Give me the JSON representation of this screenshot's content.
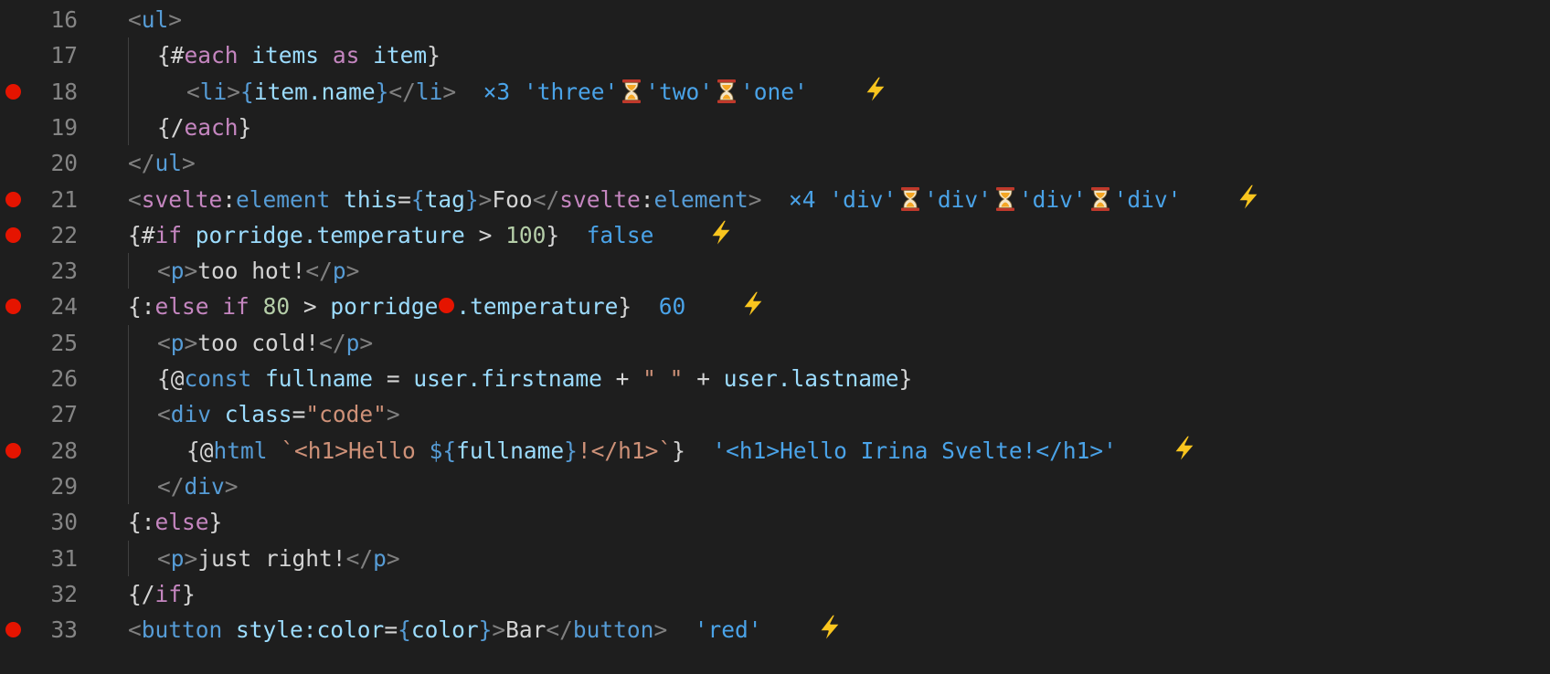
{
  "lines": [
    {
      "n": "16",
      "bp": false
    },
    {
      "n": "17",
      "bp": false
    },
    {
      "n": "18",
      "bp": true
    },
    {
      "n": "19",
      "bp": false
    },
    {
      "n": "20",
      "bp": false
    },
    {
      "n": "21",
      "bp": true
    },
    {
      "n": "22",
      "bp": true
    },
    {
      "n": "23",
      "bp": false
    },
    {
      "n": "24",
      "bp": true
    },
    {
      "n": "25",
      "bp": false
    },
    {
      "n": "26",
      "bp": false
    },
    {
      "n": "27",
      "bp": false
    },
    {
      "n": "28",
      "bp": true
    },
    {
      "n": "29",
      "bp": false
    },
    {
      "n": "30",
      "bp": false
    },
    {
      "n": "31",
      "bp": false
    },
    {
      "n": "32",
      "bp": false
    },
    {
      "n": "33",
      "bp": true
    }
  ],
  "tokens": {
    "l16": {
      "lt": "<",
      "ul": "ul",
      "gt": ">"
    },
    "l17": {
      "open": "{#",
      "each": "each",
      "items": "items",
      "as": "as",
      "item": "item",
      "close": "}"
    },
    "l18": {
      "lt": "<",
      "li": "li",
      "gt": ">",
      "ob": "{",
      "expr": "item.name",
      "cb": "}",
      "lt2": "</",
      "li2": "li",
      "gt2": ">",
      "anno_count": "×3",
      "v1": "'three'",
      "v2": "'two'",
      "v3": "'one'"
    },
    "l19": {
      "open": "{/",
      "each": "each",
      "close": "}"
    },
    "l20": {
      "lt": "</",
      "ul": "ul",
      "gt": ">"
    },
    "l21": {
      "lt": "<",
      "ns": "svelte",
      "colon": ":",
      "el": "element",
      "attr": "this",
      "eq": "=",
      "ob": "{",
      "tag": "tag",
      "cb": "}",
      "gt": ">",
      "text": "Foo",
      "lt2": "</",
      "ns2": "svelte",
      "colon2": ":",
      "el2": "element",
      "gt2": ">",
      "anno_count": "×4",
      "v1": "'div'",
      "v2": "'div'",
      "v3": "'div'",
      "v4": "'div'"
    },
    "l22": {
      "open": "{#",
      "kw": "if",
      "var": "porridge.temperature",
      "op": ">",
      "num": "100",
      "close": "}",
      "anno": "false"
    },
    "l23": {
      "lt": "<",
      "p": "p",
      "gt": ">",
      "text": "too hot!",
      "lt2": "</",
      "p2": "p",
      "gt2": ">"
    },
    "l24": {
      "open": "{:",
      "kw1": "else",
      "kw2": "if",
      "num": "80",
      "op": ">",
      "var1": "porridge",
      "var2": ".temperature",
      "close": "}",
      "anno": "60"
    },
    "l25": {
      "lt": "<",
      "p": "p",
      "gt": ">",
      "text": "too cold!",
      "lt2": "</",
      "p2": "p",
      "gt2": ">"
    },
    "l26": {
      "open": "{@",
      "kw": "const",
      "name": "fullname",
      "eq": "=",
      "v1": "user.firstname",
      "plus": "+",
      "str": "\" \"",
      "plus2": "+",
      "v2": "user.lastname",
      "close": "}"
    },
    "l27": {
      "lt": "<",
      "div": "div",
      "attr": "class",
      "eq": "=",
      "str": "\"code\"",
      "gt": ">"
    },
    "l28": {
      "open": "{@",
      "kw": "html",
      "tpl1": "`<h1>Hello ",
      "dl": "${",
      "var": "fullname",
      "rb": "}",
      "tpl2": "!</h1>`",
      "close": "}",
      "anno": "'<h1>Hello Irina Svelte!</h1>'"
    },
    "l29": {
      "lt": "</",
      "div": "div",
      "gt": ">"
    },
    "l30": {
      "open": "{:",
      "kw": "else",
      "close": "}"
    },
    "l31": {
      "lt": "<",
      "p": "p",
      "gt": ">",
      "text": "just right!",
      "lt2": "</",
      "p2": "p",
      "gt2": ">"
    },
    "l32": {
      "open": "{/",
      "kw": "if",
      "close": "}"
    },
    "l33": {
      "lt": "<",
      "el": "button",
      "attr": "style:color",
      "eq": "=",
      "ob": "{",
      "var": "color",
      "cb": "}",
      "gt": ">",
      "text": "Bar",
      "lt2": "</",
      "el2": "button",
      "gt2": ">",
      "anno": "'red'"
    }
  },
  "colors": {
    "background": "#1e1e1e",
    "line_number": "#858585",
    "breakpoint": "#e51400",
    "inline_value": "#4aa3e8",
    "tag_bracket": "#808080",
    "element": "#569cd6",
    "keyword": "#c586c0",
    "variable": "#9cdcfe",
    "string": "#ce9178",
    "number": "#b5cea8"
  },
  "icons": {
    "breakpoint": "breakpoint-dot-icon",
    "hourglass": "hourglass-icon",
    "lightning": "lightning-icon"
  }
}
